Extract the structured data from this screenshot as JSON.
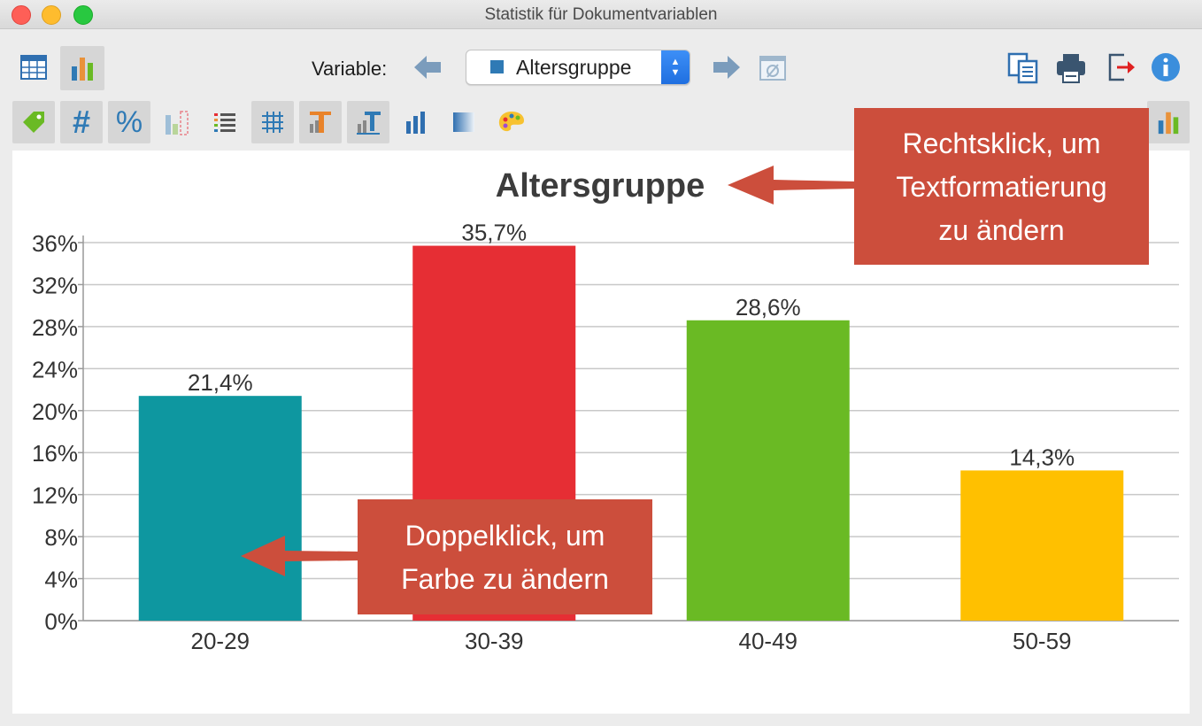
{
  "window": {
    "title": "Statistik für Dokumentvariablen"
  },
  "toolbar": {
    "variable_label": "Variable:",
    "selected_variable": "Altersgruppe",
    "selected_swatch_color": "#2f7ab5",
    "left_buttons": [
      "table-view-icon",
      "chart-view-icon"
    ],
    "right_buttons": [
      "copy-icon",
      "print-icon",
      "export-icon",
      "info-icon"
    ]
  },
  "toolbar2": {
    "buttons": [
      "tag-icon",
      "hash-icon",
      "percent-icon",
      "bar-missing-icon",
      "list-icon",
      "grid-icon",
      "title-format-icon",
      "label-format-icon",
      "bar-chart-icon",
      "gradient-icon",
      "palette-icon"
    ]
  },
  "callouts": {
    "top": "Rechtsklick, um Textformatierung zu ändern",
    "top_lines": [
      "Rechtsklick, um",
      "Textformatierung",
      "zu ändern"
    ],
    "bottom_lines": [
      "Doppelklick, um",
      "Farbe zu ändern"
    ],
    "color": "#cc4e3c"
  },
  "chart_data": {
    "type": "bar",
    "title": "Altersgruppe",
    "categories": [
      "20-29",
      "30-39",
      "40-49",
      "50-59"
    ],
    "values": [
      21.4,
      35.7,
      28.6,
      14.3
    ],
    "value_labels": [
      "21,4%",
      "35,7%",
      "28,6%",
      "14,3%"
    ],
    "colors": [
      "#0e97a0",
      "#e62e34",
      "#6aba24",
      "#ffc000"
    ],
    "ylim": [
      0,
      36
    ],
    "yticks": [
      0,
      4,
      8,
      12,
      16,
      20,
      24,
      28,
      32,
      36
    ],
    "ytick_labels": [
      "0%",
      "4%",
      "8%",
      "12%",
      "16%",
      "20%",
      "24%",
      "28%",
      "32%",
      "36%"
    ],
    "grid": true,
    "xlabel": "",
    "ylabel": ""
  }
}
